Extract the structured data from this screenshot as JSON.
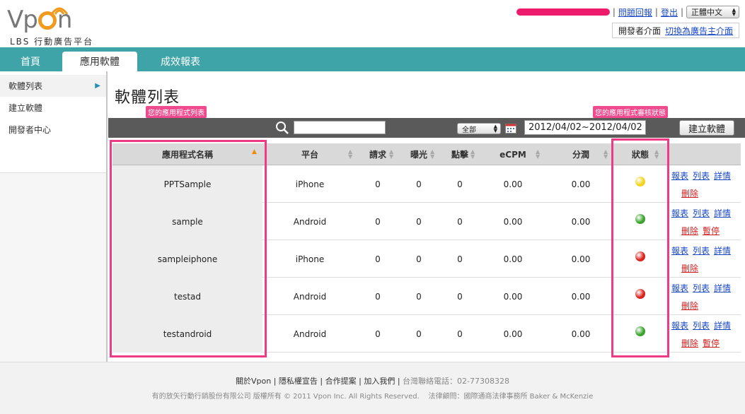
{
  "logo": {
    "word_left": "Vp",
    "word_right": "n",
    "subtitle": "LBS 行動廣告平台",
    "accent": "#f29a1d"
  },
  "topbar": {
    "report_issue": "問題回報",
    "logout": "登出",
    "language": "正體中文",
    "dev_label": "開發者介面",
    "switch_link": "切換為廣告主介面"
  },
  "nav": {
    "tabs": [
      {
        "label": "首頁"
      },
      {
        "label": "應用軟體"
      },
      {
        "label": "成效報表"
      }
    ],
    "active": 1,
    "color": "#3fa4a8"
  },
  "sidebar": {
    "items": [
      {
        "label": "軟體列表"
      },
      {
        "label": "建立軟體"
      },
      {
        "label": "開發者中心"
      }
    ]
  },
  "page": {
    "title": "軟體列表",
    "anno_list": "您的應用程式列表",
    "anno_status": "您的應用程式審核狀態"
  },
  "toolbar": {
    "search_placeholder": "",
    "filter": "全部",
    "date_range": "2012/04/02~2012/04/02",
    "new_app": "建立軟體"
  },
  "table": {
    "headers": {
      "name": "應用程式名稱",
      "platform": "平台",
      "requests": "請求",
      "impressions": "曝光",
      "clicks": "點擊",
      "ecpm": "eCPM",
      "share": "分潤",
      "status": "狀態"
    },
    "rows": [
      {
        "name": "PPTSample",
        "platform": "iPhone",
        "requests": "0",
        "impressions": "0",
        "clicks": "0",
        "ecpm": "0.00",
        "share": "0.00",
        "status": "yellow",
        "actions": [
          "報表",
          "列表",
          "詳情"
        ],
        "red_actions": [
          "刪除"
        ]
      },
      {
        "name": "sample",
        "platform": "Android",
        "requests": "0",
        "impressions": "0",
        "clicks": "0",
        "ecpm": "0.00",
        "share": "0.00",
        "status": "green",
        "actions": [
          "報表",
          "列表",
          "詳情"
        ],
        "red_actions": [
          "刪除",
          "暫停"
        ]
      },
      {
        "name": "sampleiphone",
        "platform": "iPhone",
        "requests": "0",
        "impressions": "0",
        "clicks": "0",
        "ecpm": "0.00",
        "share": "0.00",
        "status": "red",
        "actions": [
          "報表",
          "列表",
          "詳情"
        ],
        "red_actions": [
          "刪除"
        ]
      },
      {
        "name": "testad",
        "platform": "Android",
        "requests": "0",
        "impressions": "0",
        "clicks": "0",
        "ecpm": "0.00",
        "share": "0.00",
        "status": "red",
        "actions": [
          "報表",
          "列表",
          "詳情"
        ],
        "red_actions": [
          "刪除"
        ]
      },
      {
        "name": "testandroid",
        "platform": "Android",
        "requests": "0",
        "impressions": "0",
        "clicks": "0",
        "ecpm": "0.00",
        "share": "0.00",
        "status": "green",
        "actions": [
          "報表",
          "列表",
          "詳情"
        ],
        "red_actions": [
          "刪除",
          "暫停"
        ]
      }
    ]
  },
  "status_colors": {
    "yellow": "#f3d31c",
    "green": "#3aa32c",
    "red": "#d9241e"
  },
  "footer": {
    "links": [
      "關於Vpon",
      "隱私權宣告",
      "合作提案",
      "加入我們"
    ],
    "phone": "台灣聯絡電話：02-77308328",
    "copyright": "有的放矢行動行銷股份有限公司 版權所有 © 2011 Vpon Inc. All Rights Reserved.",
    "counsel": "法律顧問：國際通商法律事務所 Baker & McKenzie"
  }
}
